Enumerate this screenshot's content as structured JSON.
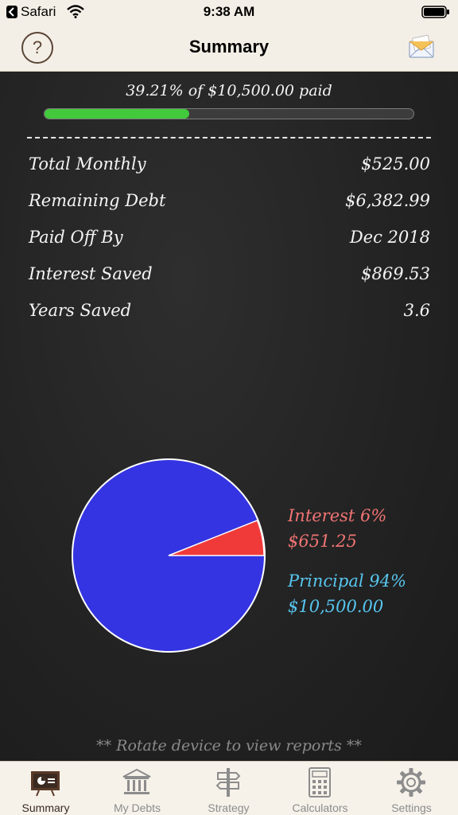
{
  "status_bar": {
    "back_app": "Safari",
    "time": "9:38 AM"
  },
  "nav": {
    "title": "Summary",
    "help_label": "?"
  },
  "progress": {
    "text": "39.21% of $10,500.00 paid",
    "fraction": 0.3921
  },
  "stats": [
    {
      "label": "Total Monthly",
      "value": "$525.00"
    },
    {
      "label": "Remaining Debt",
      "value": "$6,382.99"
    },
    {
      "label": "Paid Off By",
      "value": "Dec 2018"
    },
    {
      "label": "Interest Saved",
      "value": "$869.53"
    },
    {
      "label": "Years Saved",
      "value": "3.6"
    }
  ],
  "pie": {
    "slices": [
      {
        "name": "Interest",
        "percent": 6,
        "amount": "$651.25",
        "color": "#f03a3a"
      },
      {
        "name": "Principal",
        "percent": 94,
        "amount": "$10,500.00",
        "color": "#3434e2"
      }
    ],
    "legend": {
      "interest_line1": "Interest 6%",
      "interest_line2": "$651.25",
      "principal_line1": "Principal 94%",
      "principal_line2": "$10,500.00"
    }
  },
  "hint": "** Rotate device to view reports **",
  "tabs": [
    {
      "label": "Summary",
      "icon": "chalkboard-icon",
      "active": true
    },
    {
      "label": "My Debts",
      "icon": "bank-icon",
      "active": false
    },
    {
      "label": "Strategy",
      "icon": "signpost-icon",
      "active": false
    },
    {
      "label": "Calculators",
      "icon": "calculator-icon",
      "active": false
    },
    {
      "label": "Settings",
      "icon": "gear-icon",
      "active": false
    }
  ],
  "colors": {
    "chalk": "#f4f4f4",
    "progress": "#42c93c",
    "interest": "#f27474",
    "principal": "#57c6ee",
    "tab_active": "#3b2a20"
  }
}
